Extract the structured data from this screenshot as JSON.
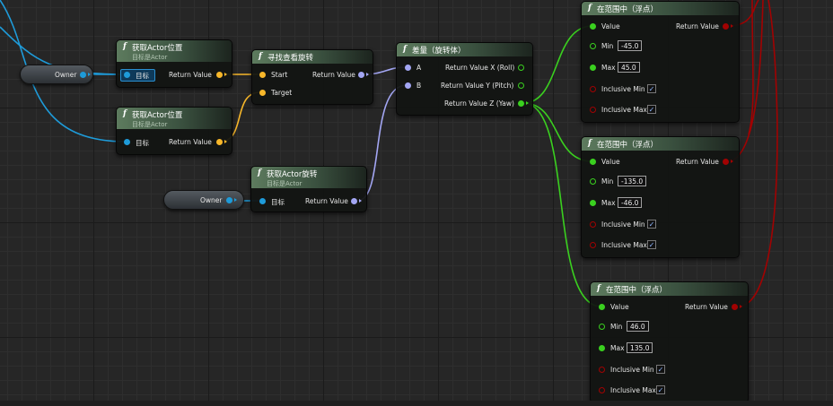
{
  "colors": {
    "object": "#1e9bd9",
    "vector": "#f7b72a",
    "rotator": "#a3a6f3",
    "float": "#3ad01f",
    "bool": "#a10202"
  },
  "vars": [
    {
      "label": "Owner"
    },
    {
      "label": "Owner"
    }
  ],
  "get_loc_1": {
    "title": "获取Actor位置",
    "sub": "目标是Actor",
    "in": "目标",
    "out": "Return Value"
  },
  "get_loc_2": {
    "title": "获取Actor位置",
    "sub": "目标是Actor",
    "in": "目标",
    "out": "Return Value"
  },
  "get_rot": {
    "title": "获取Actor旋转",
    "sub": "目标是Actor",
    "in": "目标",
    "out": "Return Value"
  },
  "find_look": {
    "title": "寻找查看旋转",
    "start": "Start",
    "target": "Target",
    "out": "Return Value"
  },
  "delta": {
    "title": "差量（旋转体）",
    "a": "A",
    "b": "B",
    "out_x": "Return Value X (Roll)",
    "out_y": "Return Value Y (Pitch)",
    "out_z": "Return Value Z (Yaw)"
  },
  "range_nodes": [
    {
      "title": "在范围中（浮点）",
      "value": "Value",
      "ret": "Return Value",
      "min_label": "Min",
      "min": "-45.0",
      "max_label": "Max",
      "max": "45.0",
      "inc_min": "Inclusive Min",
      "inc_max": "Inclusive Max",
      "inc_min_checked": true,
      "inc_max_checked": true
    },
    {
      "title": "在范围中（浮点）",
      "value": "Value",
      "ret": "Return Value",
      "min_label": "Min",
      "min": "-135.0",
      "max_label": "Max",
      "max": "-46.0",
      "inc_min": "Inclusive Min",
      "inc_max": "Inclusive Max",
      "inc_min_checked": true,
      "inc_max_checked": true
    },
    {
      "title": "在范围中（浮点）",
      "value": "Value",
      "ret": "Return Value",
      "min_label": "Min",
      "min": "46.0",
      "max_label": "Max",
      "max": "135.0",
      "inc_min": "Inclusive Min",
      "inc_max": "Inclusive Max",
      "inc_min_checked": true,
      "inc_max_checked": true
    }
  ],
  "checkmark": "✓"
}
